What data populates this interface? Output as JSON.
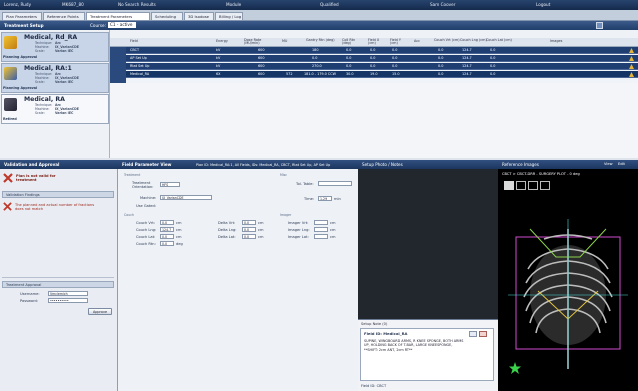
{
  "topbar": {
    "patient": "Lorenz, Rudy",
    "patient_id": "MK687_80",
    "search": "No Search Results",
    "module": "Module",
    "qualified": "Qualified",
    "user": "Sam Coover",
    "logout": "Logout"
  },
  "tabs": [
    "Plan Parameters",
    "Reference Points",
    "Treatment Parameters",
    "Scheduling",
    "3D Isodose",
    "Billing / Log"
  ],
  "treatment_panel": {
    "title": "Treatment Setup",
    "course_label": "Course:",
    "course_value": "C1 - active"
  },
  "plans": [
    {
      "name": "Medical, Rd_RA",
      "status": "Planning Approval",
      "technique_label": "Technique:",
      "technique": "Arc",
      "machine_label": "Machine:",
      "machine": "IX_VarianCDE",
      "scale_label": "Scale:",
      "scale": "Varian IEC"
    },
    {
      "name": "Medical, RA:1",
      "status": "Planning Approval",
      "technique_label": "Technique:",
      "technique": "Arc",
      "machine_label": "Machine:",
      "machine": "IX_VarianCDE",
      "scale_label": "Scale:",
      "scale": "Varian IEC"
    },
    {
      "name": "Medical, RA",
      "status": "Retired",
      "technique_label": "Technique:",
      "technique": "Arc",
      "machine_label": "Machine:",
      "machine": "IX_VarianCDE",
      "scale_label": "Scale:",
      "scale": "Varian IEC"
    }
  ],
  "grid_headers": [
    "Field",
    "Energy",
    "Dose Rate (MU/min)",
    "MU",
    "Gantry Rtn (deg)",
    "Coll Rtn (deg)",
    "Field X (cm)",
    "Field Y (cm)",
    "Acc",
    "Couch Vrt (cm)",
    "Couch Lng (cm)",
    "Couch Lat (cm)",
    "Images"
  ],
  "grid_rows": [
    {
      "field": "CBCT",
      "energy": "kV",
      "dose": "600",
      "mu": "",
      "gantry": "180",
      "coll": "0.0",
      "fx": "0.0",
      "fy": "0.0",
      "vrt": "0.0",
      "lng": "124.7",
      "lat": "0.0"
    },
    {
      "field": "AP Set Up",
      "energy": "kV",
      "dose": "600",
      "mu": "",
      "gantry": "0.0",
      "coll": "0.0",
      "fx": "0.0",
      "fy": "0.0",
      "vrt": "0.0",
      "lng": "124.7",
      "lat": "0.0"
    },
    {
      "field": "Rtat Set Up",
      "energy": "kV",
      "dose": "600",
      "mu": "",
      "gantry": "270.0",
      "coll": "0.0",
      "fx": "0.0",
      "fy": "0.0",
      "vrt": "0.0",
      "lng": "124.7",
      "lat": "0.0"
    },
    {
      "field": "Medical_RA",
      "energy": "6X",
      "dose": "600",
      "mu": "572",
      "gantry": "181.0 - 179.0 CCW",
      "coll": "30.0",
      "fx": "19.0",
      "fy": "15.0",
      "vrt": "0.0",
      "lng": "124.7",
      "lat": "0.0"
    }
  ],
  "lower_header": {
    "left": "Validation and Approval",
    "mid": "Field Parameter View",
    "plan_id": "Plan ID: Medical_RA:1, All Fields, IDs: Medical_RA, CBCT, Rtat Set Up, AP Set Up",
    "setup": "Setup Photo / Notes",
    "ref": "Reference Images"
  },
  "validation": {
    "error_title": "Plan is not valid for treatment",
    "findings_title": "Validation Findings",
    "finding": "The planned and actual number of fractions does not match",
    "approval_title": "Treatment Approval",
    "username_label": "Username:",
    "username": "Vmclemjch",
    "password_label": "Password:",
    "password": "••••••••••",
    "approve_button": "Approve"
  },
  "field_params": {
    "section_treatment": "Treatment",
    "orientation_label": "Treatment Orientation:",
    "orientation_value": "HFS",
    "machine_label": "Machine:",
    "machine_value": "IX_VarianCDE",
    "use_gated_label": "Use Gated:",
    "section_couch": "Couch",
    "misc_section": "Misc",
    "tol_table_label": "Tol. Table:",
    "time_label": "Time:",
    "time_value": "1.29",
    "time_unit": "min",
    "couch_rows": [
      {
        "label": "Couch Vrt:",
        "value": "0.0",
        "unit": "cm",
        "delta_label": "Delta Vrt:",
        "delta": "0.0",
        "img_label": "Imager Vrt:"
      },
      {
        "label": "Couch Lng:",
        "value": "124.7",
        "unit": "cm",
        "delta_label": "Delta Lng:",
        "delta": "0.0",
        "img_label": "Imager Lng:"
      },
      {
        "label": "Couch Lat:",
        "value": "0.0",
        "unit": "cm",
        "delta_label": "Delta Lat:",
        "delta": "0.0",
        "img_label": "Imager Lat:"
      },
      {
        "label": "Couch Rtn:",
        "value": "0.0",
        "unit": "deg"
      }
    ],
    "section_imager": "Imager"
  },
  "setup_notes": {
    "header": "Setup Note (0)",
    "field_id": "Field ID: Medical_RA",
    "note": "SUPINE, WINGBOARD ARMS, R KNEE SPONGE, BOTH ARMS UP, HOLDING BACK OF T-BAR, LARGE KNEESPONGE, **SHIFT: 2cm ANT, 2cm RT**",
    "footer": "Field ID: CBCT"
  },
  "ref_images": {
    "label": "CBCT > CBCT-DRR - SURGERY PLOT - 0 deg",
    "view_label": "View",
    "edit_label": "Edit"
  },
  "colors": {
    "header_dark": "#1f3f73",
    "row_selected": "#1f3f73",
    "error_red": "#c0392b",
    "warning_gold": "#e3b33b"
  }
}
